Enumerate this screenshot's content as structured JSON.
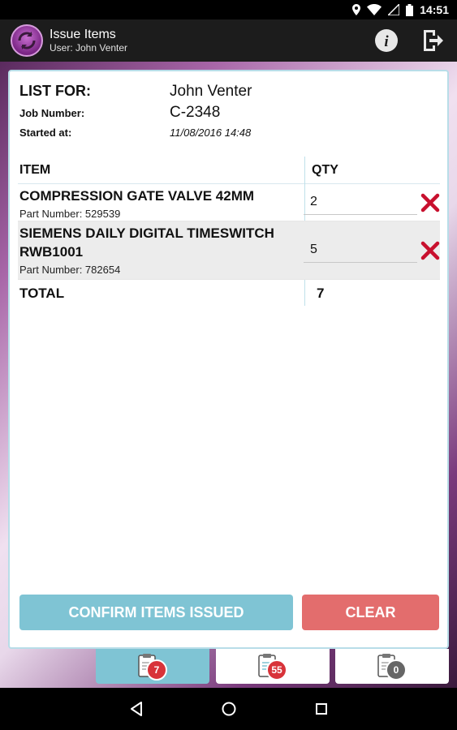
{
  "status_bar": {
    "time": "14:51"
  },
  "app_bar": {
    "title": "Issue Items",
    "user": "User: John Venter"
  },
  "info": {
    "list_for_label": "LIST FOR:",
    "list_for_value": "John Venter",
    "job_number_label": "Job Number:",
    "job_number_value": "C-2348",
    "started_label": "Started at:",
    "started_value": "11/08/2016 14:48"
  },
  "table": {
    "headers": {
      "item": "ITEM",
      "qty": "QTY"
    },
    "rows": [
      {
        "name": "COMPRESSION GATE VALVE 42MM",
        "part_number": "Part Number: 529539",
        "qty": "2"
      },
      {
        "name": "SIEMENS DAILY DIGITAL TIMESWITCH RWB1001",
        "part_number": "Part Number: 782654",
        "qty": "5"
      }
    ],
    "total_label": "TOTAL",
    "total_value": "7"
  },
  "buttons": {
    "confirm": "CONFIRM ITEMS ISSUED",
    "clear": "CLEAR"
  },
  "tabs": [
    {
      "icon": "clipboard-icon",
      "badge": "7"
    },
    {
      "icon": "clipboard-icon",
      "badge": "55"
    },
    {
      "icon": "clipboard-icon",
      "badge": "0"
    }
  ],
  "colors": {
    "accent": "#7fc4d4",
    "danger": "#e36d6d",
    "delete_icon": "#c8102e",
    "badge_red": "#d8333a",
    "badge_grey": "#666666"
  }
}
